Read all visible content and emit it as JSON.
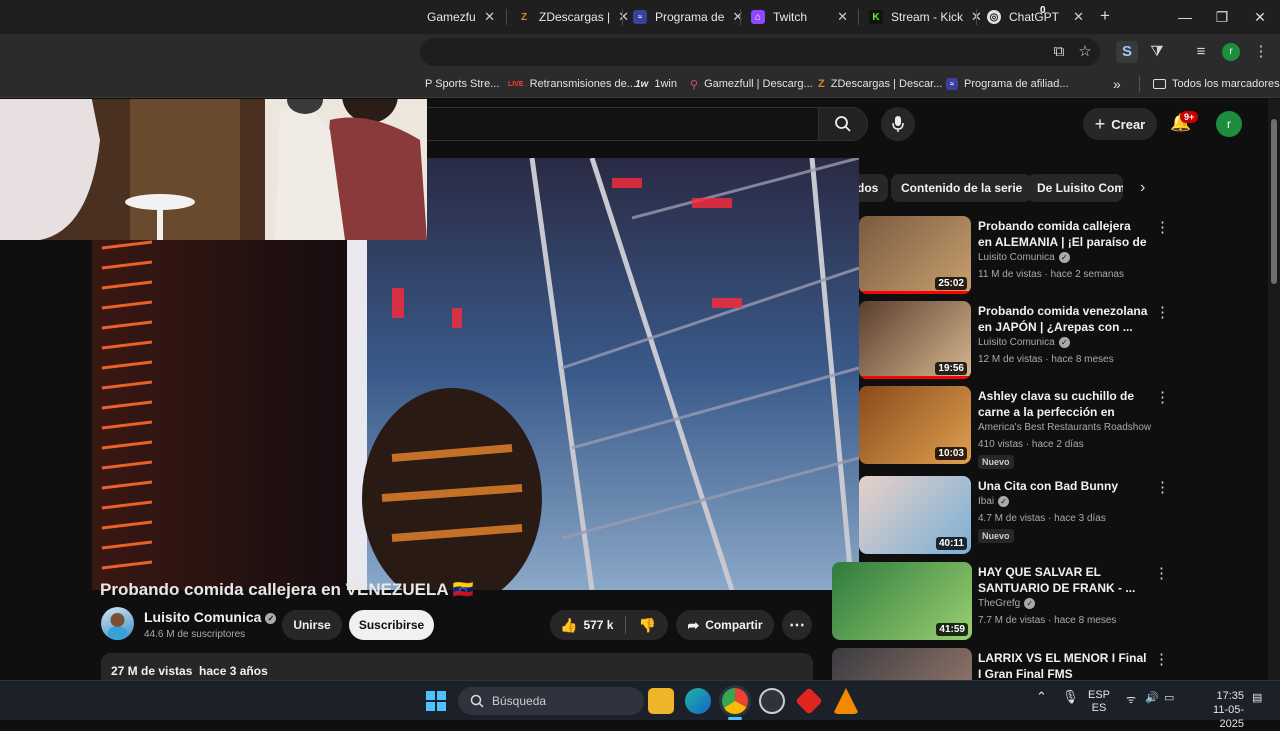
{
  "browser": {
    "tabs": [
      {
        "label": "Gamezfull | D",
        "favicon": "gamezfull-icon",
        "color": "#2b2b2b"
      },
      {
        "label": "ZDescargas |",
        "favicon": "zdescargas-icon",
        "color": "#c07a1a"
      },
      {
        "label": "Programa de",
        "favicon": "twitch-affiliate-icon",
        "color": "#3b3f9e"
      },
      {
        "label": "Twitch",
        "favicon": "twitch-icon",
        "color": "#9146ff"
      },
      {
        "label": "Stream - Kick",
        "favicon": "kick-icon",
        "color": "#53fc18"
      },
      {
        "label": "ChatGPT",
        "favicon": "chatgpt-icon",
        "color": "#e0e0e0"
      }
    ],
    "tab_count_badge": "0",
    "bookmarks": [
      {
        "label": "P Sports Stre...",
        "icon": "sports-icon"
      },
      {
        "label": "Retransmisiones de...",
        "icon": "live-icon"
      },
      {
        "label": "1win",
        "icon": "1win-icon"
      },
      {
        "label": "Gamezfull | Descarg...",
        "icon": "gamezfull-icon"
      },
      {
        "label": "ZDescargas | Descar...",
        "icon": "zdescargas-icon"
      },
      {
        "label": "Programa de afiliad...",
        "icon": "twitch-affiliate-icon"
      }
    ],
    "all_bookmarks_label": "Todos los marcadores",
    "profile_initial": "r"
  },
  "youtube": {
    "create_label": "Crear",
    "notifications_badge": "9+",
    "avatar_initial": "r",
    "chips": [
      "dos",
      "Contenido de la serie",
      "De Luisito Comu"
    ],
    "video": {
      "title": "Probando comida callejera en VENEZUELA 🇻🇪",
      "channel": "Luisito Comunica",
      "subscribers": "44.6 M de suscriptores",
      "join_label": "Unirse",
      "subscribe_label": "Suscribirse",
      "likes": "577 k",
      "share_label": "Compartir",
      "views": "27 M de vistas",
      "date": "hace 3 años"
    },
    "recommendations": [
      {
        "title": "Probando comida callejera en ALEMANIA | ¡El paraíso de la ...",
        "channel": "Luisito Comunica",
        "verified": true,
        "meta": "11 M de vistas · hace 2 semanas",
        "duration": "25:02",
        "badge": "",
        "progress": 1.0,
        "thumb_colors": [
          "#7a5a3e",
          "#c9a070"
        ]
      },
      {
        "title": "Probando comida venezolana en JAPÓN | ¿Arepas con ...",
        "channel": "Luisito Comunica",
        "verified": true,
        "meta": "12 M de vistas · hace 8 meses",
        "duration": "19:56",
        "badge": "",
        "progress": 1.0,
        "thumb_colors": [
          "#5a3e2e",
          "#d8b890"
        ]
      },
      {
        "title": "Ashley clava su cuchillo de carne a la perfección en Bandi...",
        "channel": "America's Best Restaurants Roadshow",
        "verified": false,
        "meta": "410 vistas · hace 2 días",
        "duration": "10:03",
        "badge": "Nuevo",
        "progress": 0,
        "thumb_colors": [
          "#8a4a1a",
          "#e0a050"
        ]
      },
      {
        "title": "Una Cita con Bad Bunny",
        "channel": "Ibai",
        "verified": true,
        "meta": "4.7 M de vistas · hace 3 días",
        "duration": "40:11",
        "badge": "Nuevo",
        "progress": 0,
        "thumb_colors": [
          "#e8d0c8",
          "#7ab0d8"
        ]
      },
      {
        "title": "HAY QUE SALVAR EL SANTUARIO DE FRANK - ...",
        "channel": "TheGrefg",
        "verified": true,
        "meta": "7.7 M de vistas · hace 8 meses",
        "duration": "41:59",
        "badge": "",
        "progress": 0,
        "thumb_colors": [
          "#2e7a3e",
          "#9ad070"
        ]
      },
      {
        "title": "LARRIX VS EL MENOR I Final I Gran Final FMS Internacional ...",
        "channel": "",
        "verified": false,
        "meta": "",
        "duration": "",
        "badge": "",
        "progress": 0,
        "thumb_colors": [
          "#3a3a40",
          "#a08070"
        ]
      }
    ]
  },
  "taskbar": {
    "search_placeholder": "Búsqueda",
    "lang": "ESP",
    "lang_sub": "ES",
    "time": "17:35",
    "date": "11-05-2025"
  }
}
